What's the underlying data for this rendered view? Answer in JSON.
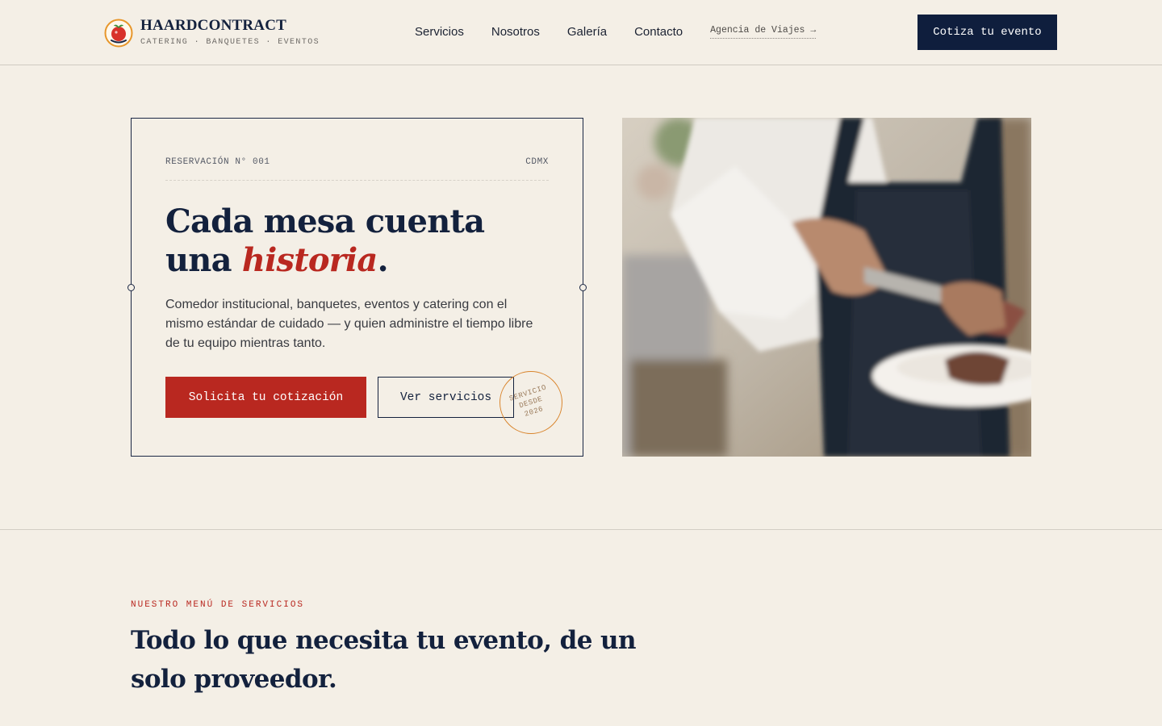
{
  "header": {
    "brand_name": "HAARDCONTRACT",
    "brand_tagline": "CATERING · BANQUETES · EVENTOS",
    "logo_icon": "tomato-logo-icon",
    "nav": [
      {
        "label": "Servicios"
      },
      {
        "label": "Nosotros"
      },
      {
        "label": "Galería"
      },
      {
        "label": "Contacto"
      }
    ],
    "agency_link": "Agencia de Viajes →",
    "cta_label": "Cotiza tu evento"
  },
  "hero": {
    "reservation_label": "RESERVACIÓN N° 001",
    "location": "CDMX",
    "title_line1": "Cada mesa cuenta",
    "title_line2_prefix": "una ",
    "title_accent": "historia",
    "title_suffix": ".",
    "description": "Comedor institucional, banquetes, eventos y catering con el mismo estándar de cuidado — y quien administre el tiempo libre de tu equipo mientras tanto.",
    "primary_button": "Solicita tu cotización",
    "secondary_button": "Ver servicios",
    "stamp": {
      "line1": "SERVICIO",
      "line2": "DESDE",
      "line3": "2026"
    },
    "image_icon": "waiter-serving-photo"
  },
  "services": {
    "kicker": "NUESTRO MENÚ DE SERVICIOS",
    "title": "Todo lo que necesita tu evento, de un solo proveedor."
  },
  "colors": {
    "background": "#f4efe6",
    "navy": "#0f1e3d",
    "accent_red": "#b92820",
    "stamp_orange": "#d9852d"
  }
}
